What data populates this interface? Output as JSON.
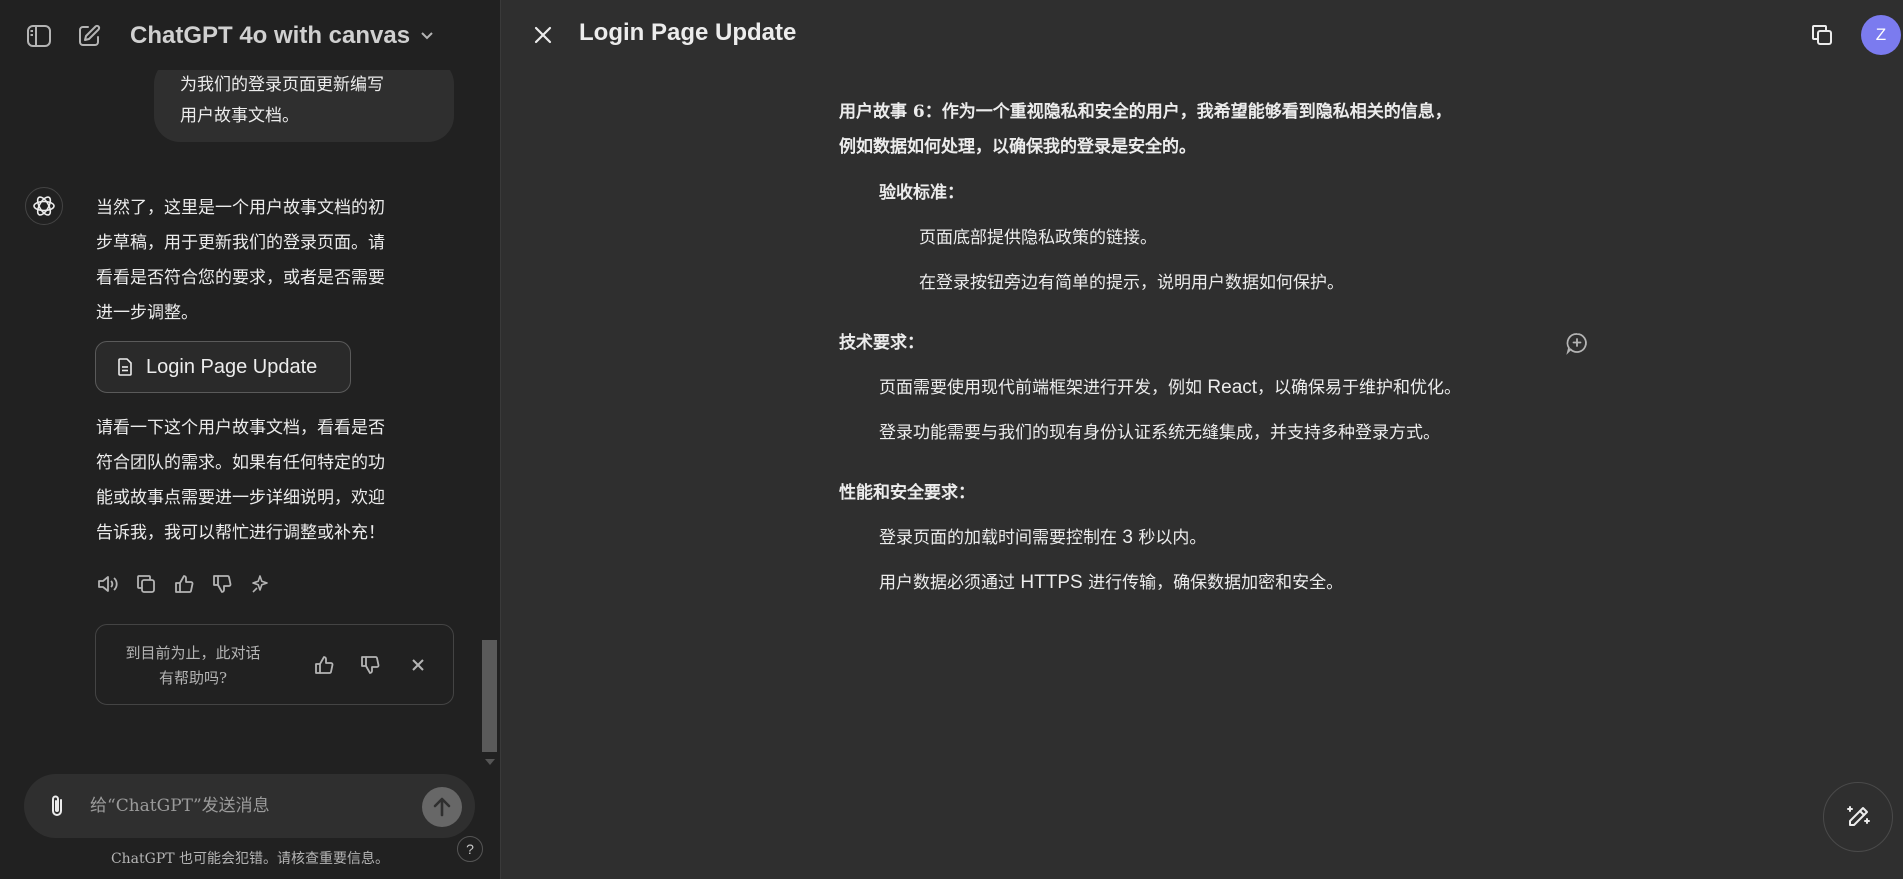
{
  "header": {
    "model_name": "ChatGPT 4o with canvas"
  },
  "chat": {
    "user_message_lines": [
      "为我们的登录页面更新编写",
      "用户故事文档。"
    ],
    "assistant_message_1_lines": [
      "当然了，这里是一个用户故事文档的初",
      "步草稿，用于更新我们的登录页面。请",
      "看看是否符合您的要求，或者是否需要",
      "进一步调整。"
    ],
    "doc_chip_label": "Login Page Update",
    "assistant_message_2_lines": [
      "请看一下这个用户故事文档，看看是否",
      "符合团队的需求。如果有任何特定的功",
      "能或故事点需要进一步详细说明，欢迎",
      "告诉我，我可以帮忙进行调整或补充！"
    ],
    "feedback_lines": [
      "到目前为止，此对话",
      "有帮助吗?"
    ]
  },
  "composer": {
    "placeholder": "给“ChatGPT”发送消息",
    "disclaimer": "ChatGPT 也可能会犯错。请核查重要信息。",
    "help_label": "?"
  },
  "canvas": {
    "title": "Login Page Update",
    "user_initial": "Z",
    "story6_line1": "用户故事 6：作为一个重视隐私和安全的用户，我希望能够看到隐私相关的信息，",
    "story6_line2": "例如数据如何处理，以确保我的登录是安全的。",
    "acceptance_heading": "验收标准：",
    "acceptance_items": [
      "页面底部提供隐私政策的链接。",
      "在登录按钮旁边有简单的提示，说明用户数据如何保护。"
    ],
    "tech_heading": "技术要求：",
    "tech_item1_a": "页面需要使用现代前端框架进行开发，例如 ",
    "tech_item1_b": "React",
    "tech_item1_c": "，以确保易于维护和优化。",
    "tech_item2": "登录功能需要与我们的现有身份认证系统无缝集成，并支持多种登录方式。",
    "perf_heading": "性能和安全要求：",
    "perf_item1_a": "登录页面的加载时间需要控制在 ",
    "perf_item1_b": "3",
    "perf_item1_c": " 秒以内。",
    "perf_item2_a": "用户数据必须通过 ",
    "perf_item2_b": "HTTPS",
    "perf_item2_c": " 进行传输，确保数据加密和安全。"
  },
  "colors": {
    "sidebar_bg": "#212121",
    "canvas_bg": "#2f2f2f",
    "avatar": "#7b7bef"
  },
  "icons": [
    "sidebar-toggle-icon",
    "new-chat-icon",
    "chevron-down-icon",
    "chatgpt-logo-icon",
    "document-icon",
    "read-aloud-icon",
    "copy-icon",
    "thumbs-up-icon",
    "thumbs-down-icon",
    "regenerate-icon",
    "close-icon",
    "paperclip-icon",
    "arrow-up-icon",
    "add-comment-icon",
    "edit-pencil-icon"
  ]
}
